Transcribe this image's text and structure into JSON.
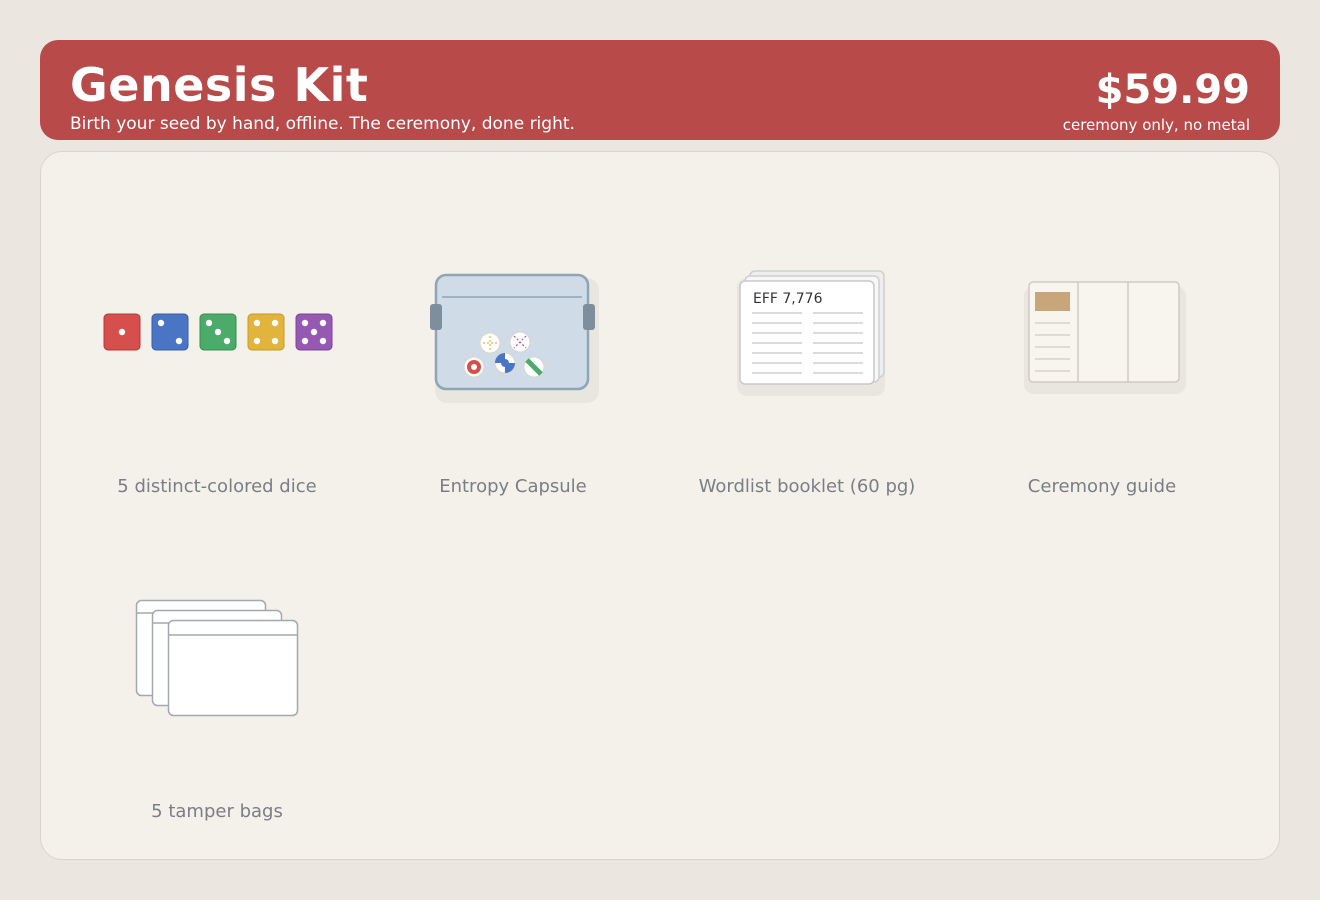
{
  "header": {
    "title": "Genesis Kit",
    "subtitle": "Birth your seed by hand, offline. The ceremony, done right.",
    "price": "$59.99",
    "price_note": "ceremony only, no metal"
  },
  "items": [
    {
      "label": "5 distinct-colored dice",
      "icon": "dice-icon"
    },
    {
      "label": "Entropy Capsule",
      "icon": "capsule-icon"
    },
    {
      "label": "Wordlist booklet (60 pg)",
      "icon": "booklet-icon",
      "booklet_text": "EFF  7,776"
    },
    {
      "label": "Ceremony guide",
      "icon": "guide-icon"
    },
    {
      "label": "5 tamper bags",
      "icon": "tamper-bags-icon"
    }
  ],
  "colors": {
    "header": "#b84a4a",
    "dice": [
      "#d64f4c",
      "#4a74c4",
      "#4aab6b",
      "#e2b43c",
      "#9659b3"
    ]
  }
}
